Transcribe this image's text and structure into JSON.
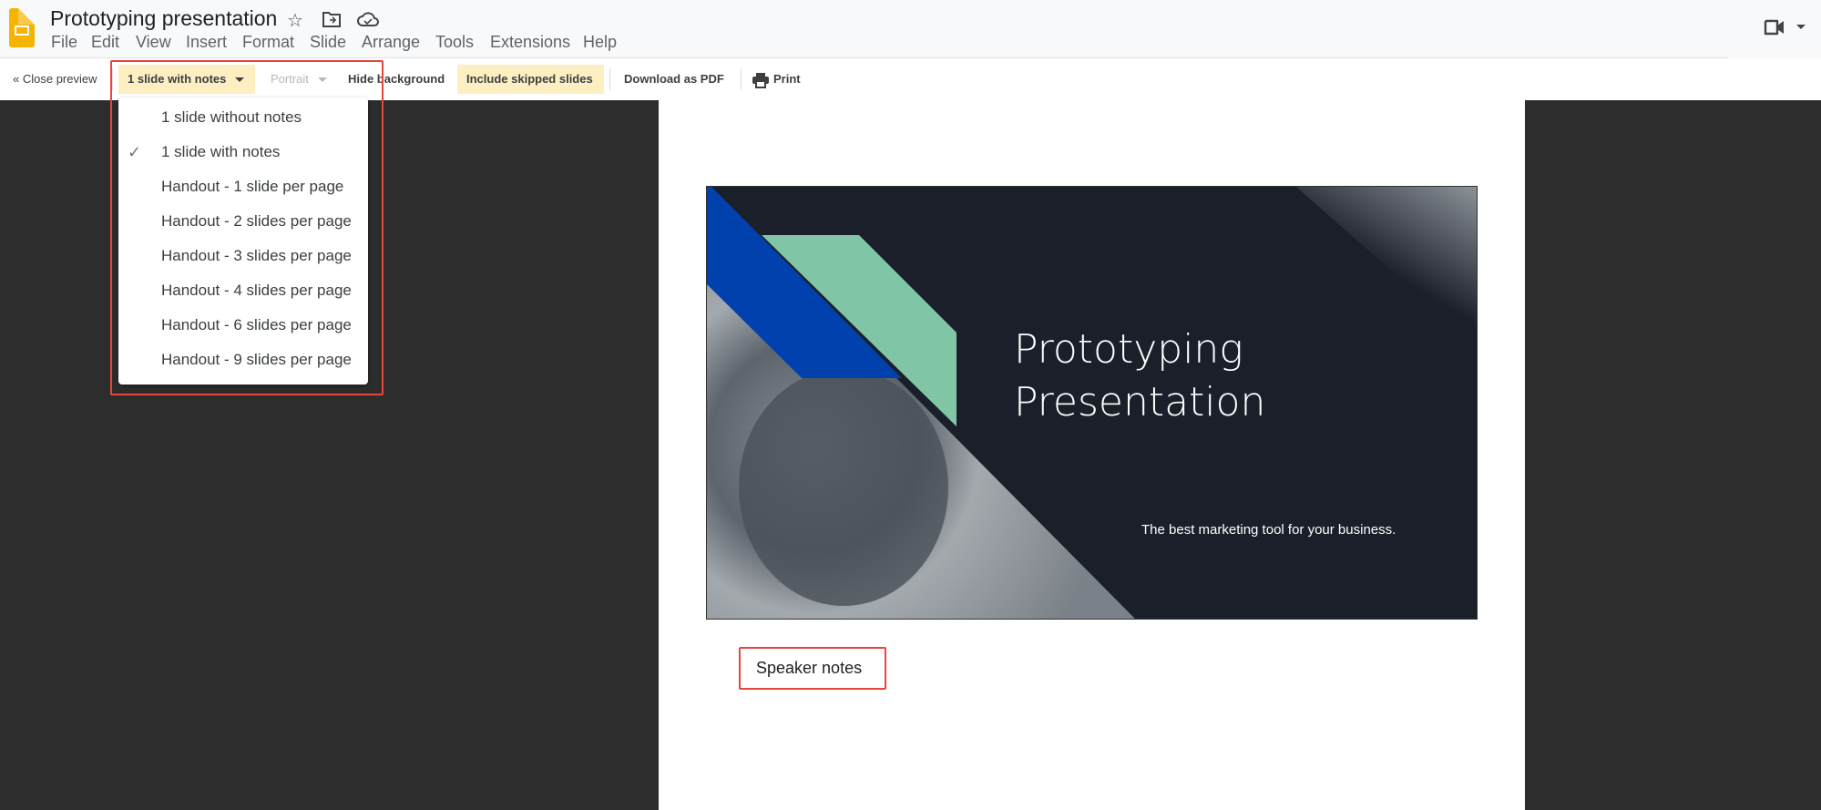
{
  "app": {
    "title": "Prototyping presentation",
    "icons": [
      "slides-logo-icon",
      "star-icon",
      "move-to-folder-icon",
      "cloud-saved-icon",
      "meet-camera-icon"
    ]
  },
  "menubar": [
    "File",
    "Edit",
    "View",
    "Insert",
    "Format",
    "Slide",
    "Arrange",
    "Tools",
    "Extensions",
    "Help"
  ],
  "toolbar": {
    "close_preview": "« Close preview",
    "layout_selected": "1 slide with notes",
    "orientation": "Portrait",
    "hide_background": "Hide background",
    "include_skipped": "Include skipped slides",
    "download_pdf": "Download as PDF",
    "print": "Print"
  },
  "dropdown": {
    "items": [
      {
        "label": "1 slide without notes",
        "checked": false
      },
      {
        "label": "1 slide with notes",
        "checked": true
      },
      {
        "label": "Handout - 1 slide per page",
        "checked": false
      },
      {
        "label": "Handout - 2 slides per page",
        "checked": false
      },
      {
        "label": "Handout - 3 slides per page",
        "checked": false
      },
      {
        "label": "Handout - 4 slides per page",
        "checked": false
      },
      {
        "label": "Handout - 6 slides per page",
        "checked": false
      },
      {
        "label": "Handout - 9 slides per page",
        "checked": false
      }
    ],
    "check_glyph": "✓"
  },
  "slide": {
    "title_line1": "Prototyping",
    "title_line2": "Presentation",
    "subtitle": "The best marketing tool for your business.",
    "colors": {
      "background": "#1b1f2a",
      "blue": "#0041ad",
      "green": "#80c5a5"
    }
  },
  "notes": {
    "label": "Speaker notes"
  },
  "colors": {
    "highlight": "#feefc3",
    "annotation": "#e8453c",
    "logo": "#f6b400"
  }
}
